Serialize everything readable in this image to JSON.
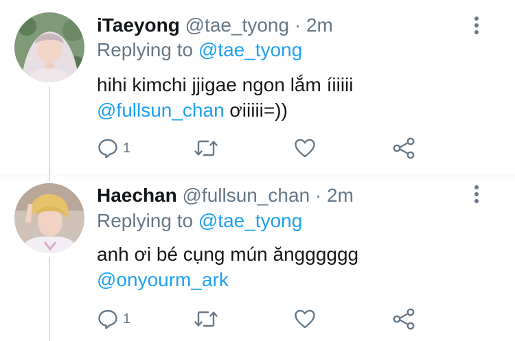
{
  "tweets": [
    {
      "name": "iTaeyong",
      "handle": "@tae_tyong",
      "separator": "·",
      "time": "2m",
      "replying_prefix": "Replying to",
      "replying_to": "@tae_tyong",
      "body_line1": "hihi kimchi jjigae ngon lắm íiiiii",
      "body_mention": "@fullsun_chan",
      "body_line2_rest": " ơiiiii=))",
      "reply_count": "1",
      "icons": [
        "reply-icon",
        "retweet-icon",
        "heart-icon",
        "share-icon",
        "more-icon"
      ]
    },
    {
      "name": "Haechan",
      "handle": "@fullsun_chan",
      "separator": "·",
      "time": "2m",
      "replying_prefix": "Replying to",
      "replying_to": "@tae_tyong",
      "body_line1": "anh ơi bé cụng mún ăngggggg",
      "body_mention": "@onyourm_ark",
      "body_line2_rest": "",
      "reply_count": "1",
      "icons": [
        "reply-icon",
        "retweet-icon",
        "heart-icon",
        "share-icon",
        "more-icon"
      ]
    }
  ],
  "colors": {
    "text": "#14171a",
    "secondary": "#657786",
    "link": "#1da1f2",
    "thread_line": "#d9dde1"
  }
}
